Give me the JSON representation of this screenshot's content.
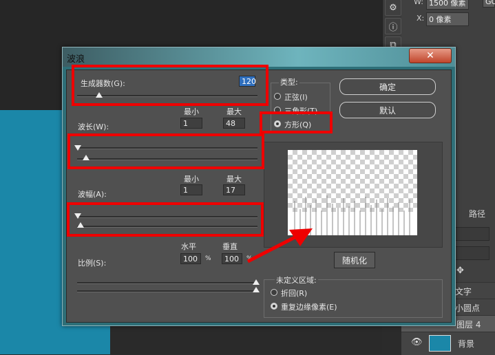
{
  "background_app": {
    "properties": {
      "w_label": "W:",
      "w_value": "1500 像素",
      "x_label": "X:",
      "x_value": "0 像素",
      "go_label": "GO"
    },
    "panel_tab": "路径",
    "layers": [
      {
        "name": "文字"
      },
      {
        "name": "小圆点"
      },
      {
        "name": "图层 4",
        "selected": true
      },
      {
        "name": "背景",
        "thumb_color": "#1b87a8"
      }
    ]
  },
  "dialog": {
    "title": "波浪",
    "close_glyph": "✕",
    "generators": {
      "label": "生成器数(G):",
      "value": "120"
    },
    "wavelength": {
      "label": "波长(W):",
      "min_label": "最小",
      "max_label": "最大",
      "min": "1",
      "max": "48"
    },
    "amplitude": {
      "label": "波幅(A):",
      "min_label": "最小",
      "max_label": "最大",
      "min": "1",
      "max": "17"
    },
    "scale": {
      "label": "比例(S):",
      "h_label": "水平",
      "v_label": "垂直",
      "h": "100",
      "v": "100",
      "unit": "%"
    },
    "type": {
      "label": "类型:",
      "options": [
        {
          "label": "正弦(I)",
          "selected": false
        },
        {
          "label": "三角形(T)",
          "selected": false
        },
        {
          "label": "方形(Q)",
          "selected": true
        }
      ]
    },
    "buttons": {
      "ok": "确定",
      "default": "默认",
      "randomize": "随机化"
    },
    "undefined_area": {
      "label": "未定义区域:",
      "options": [
        {
          "label": "折回(R)",
          "selected": false
        },
        {
          "label": "重复边缘像素(E)",
          "selected": true
        }
      ]
    }
  },
  "highlight_color": "#ee0000"
}
